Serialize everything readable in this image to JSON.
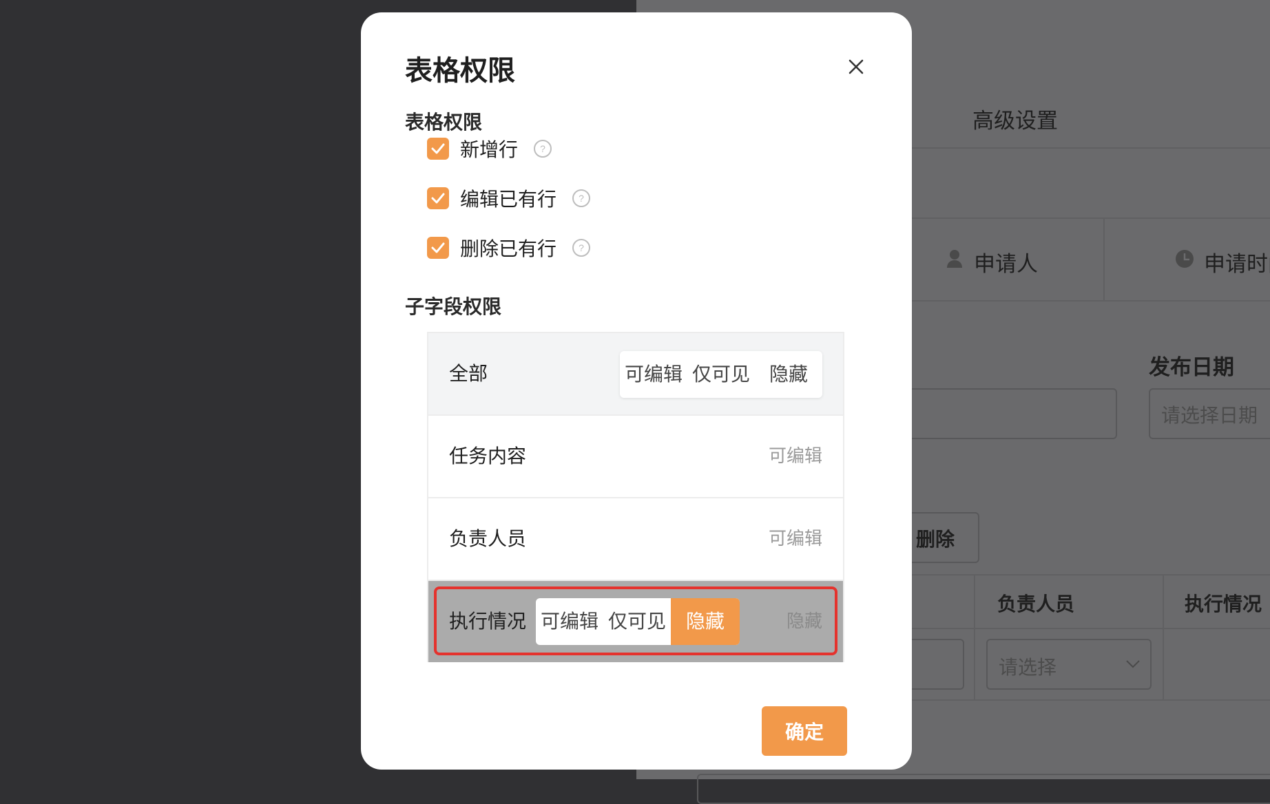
{
  "background": {
    "advanced_settings_tab": "高级设置",
    "column_applicant": "申请人",
    "column_apply_time": "申请时间",
    "publish_date_label": "发布日期",
    "date_placeholder": "请选择日期",
    "delete_button": "删除",
    "table_header_owner": "负责人员",
    "table_header_status": "执行情况",
    "select_placeholder": "请选择"
  },
  "modal": {
    "title": "表格权限",
    "close_icon": "close-icon",
    "table_permissions_title": "表格权限",
    "table_permissions": [
      {
        "label": "新增行",
        "checked": true
      },
      {
        "label": "编辑已有行",
        "checked": true
      },
      {
        "label": "删除已有行",
        "checked": true
      }
    ],
    "subfield_permissions_title": "子字段权限",
    "fields": [
      {
        "name": "全部",
        "options": [
          "可编辑",
          "仅可见",
          "隐藏"
        ]
      },
      {
        "name": "任务内容",
        "status": "可编辑"
      },
      {
        "name": "负责人员",
        "status": "可编辑"
      },
      {
        "name": "执行情况",
        "options": [
          "可编辑",
          "仅可见",
          "隐藏"
        ],
        "selected": "隐藏",
        "status": "隐藏"
      }
    ],
    "confirm_button": "确定"
  },
  "colors": {
    "accent": "#f2994a",
    "highlight": "#e5322d"
  }
}
